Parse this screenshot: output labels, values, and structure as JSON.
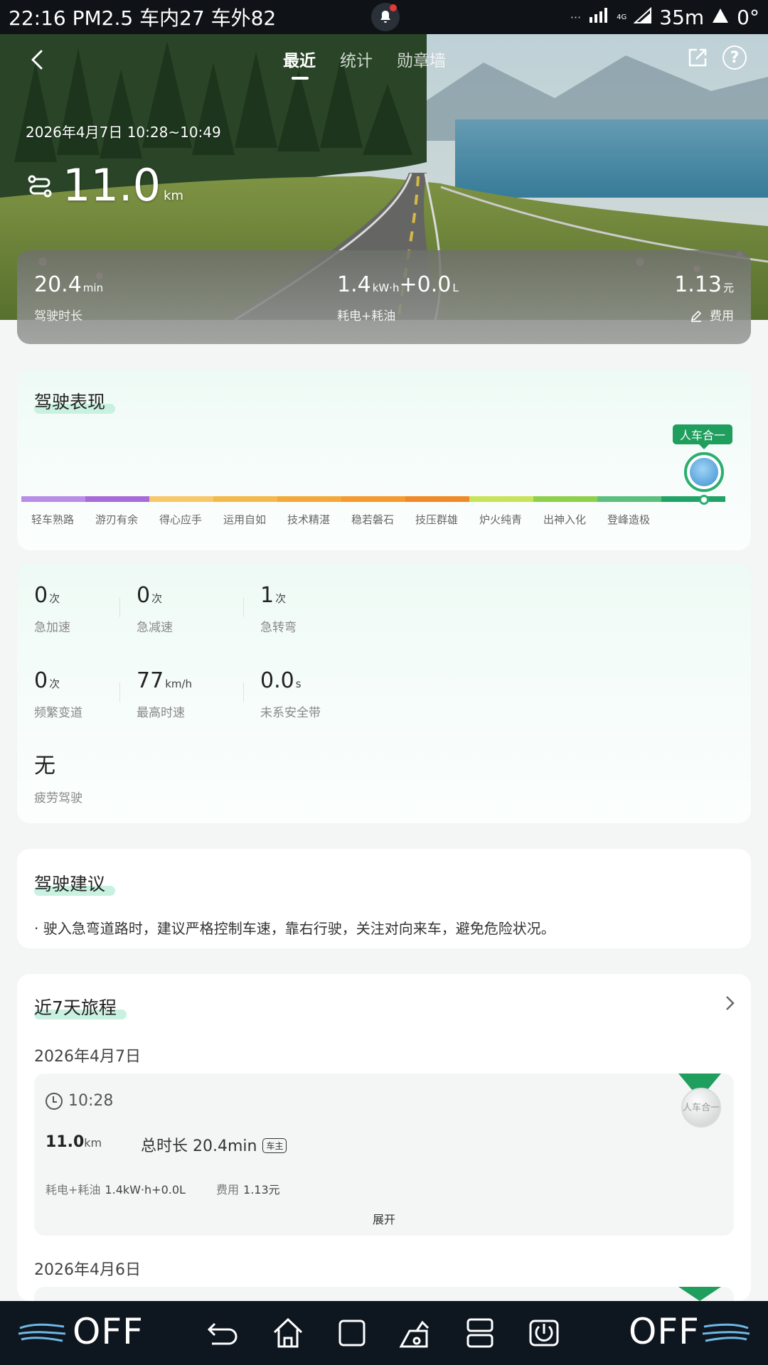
{
  "status_bar": {
    "left_text": "22:16 PM2.5 车内27 车外82",
    "signal": "4G",
    "right_text": "35m",
    "temp": "0°"
  },
  "nav": {
    "tabs": [
      {
        "label": "最近",
        "active": true
      },
      {
        "label": "统计",
        "active": false
      },
      {
        "label": "勋章墙",
        "active": false
      }
    ]
  },
  "trip": {
    "datetime": "2026年4月7日 10:28~10:49",
    "distance": "11.0",
    "distance_unit": "km",
    "duration": {
      "value": "20.4",
      "unit": "min",
      "label": "驾驶时长"
    },
    "energy": {
      "value_a": "1.4",
      "unit_a": "kW·h",
      "value_b": "+0.0",
      "unit_b": "L",
      "label": "耗电+耗油"
    },
    "cost": {
      "value": "1.13",
      "unit": "元",
      "label": "费用"
    }
  },
  "performance": {
    "title": "驾驶表现",
    "badge": "人车合一",
    "current_level_index": 10,
    "levels": [
      {
        "label": "轻车熟路",
        "color": "#b98de6"
      },
      {
        "label": "游刃有余",
        "color": "#a86ad8"
      },
      {
        "label": "得心应手",
        "color": "#f7c86a"
      },
      {
        "label": "运用自如",
        "color": "#f3b94a"
      },
      {
        "label": "技术精湛",
        "color": "#f2a93a"
      },
      {
        "label": "稳若磐石",
        "color": "#f49a2f"
      },
      {
        "label": "技压群雄",
        "color": "#f08a28"
      },
      {
        "label": "炉火纯青",
        "color": "#c6e35a"
      },
      {
        "label": "出神入化",
        "color": "#8fd04b"
      },
      {
        "label": "登峰造极",
        "color": "#5cbf7e"
      },
      {
        "label": "",
        "color": "#22a266"
      }
    ]
  },
  "metrics": [
    {
      "value": "0",
      "unit": "次",
      "label": "急加速"
    },
    {
      "value": "0",
      "unit": "次",
      "label": "急减速"
    },
    {
      "value": "1",
      "unit": "次",
      "label": "急转弯"
    },
    {
      "value": "0",
      "unit": "次",
      "label": "频繁变道"
    },
    {
      "value": "77",
      "unit": "km/h",
      "label": "最高时速"
    },
    {
      "value": "0.0",
      "unit": "s",
      "label": "未系安全带"
    },
    {
      "value": "无",
      "unit": "",
      "label": "疲劳驾驶"
    }
  ],
  "advice": {
    "title": "驾驶建议",
    "text": "·  驶入急弯道路时，建议严格控制车速，靠右行驶，关注对向来车，避免危险状况。"
  },
  "recent_trips": {
    "title": "近7天旅程",
    "days": [
      {
        "date": "2026年4月7日",
        "time": "10:28",
        "km": "11.0",
        "km_unit": "km",
        "duration": "总时长 20.4min",
        "owner_tag": "车主",
        "energy_label": "耗电+耗油",
        "energy_value": "1.4kW·h+0.0L",
        "cost_label": "费用",
        "cost_value": "1.13元",
        "expand": "展开",
        "medal_text": "人车合一"
      },
      {
        "date": "2026年4月6日"
      }
    ]
  },
  "bottom_bar": {
    "left_fan": "OFF",
    "right_fan": "OFF"
  },
  "colors": {
    "accent_green": "#1f9e5e",
    "highlight": "#c9f1e1",
    "nav_bg": "#0e1620"
  }
}
